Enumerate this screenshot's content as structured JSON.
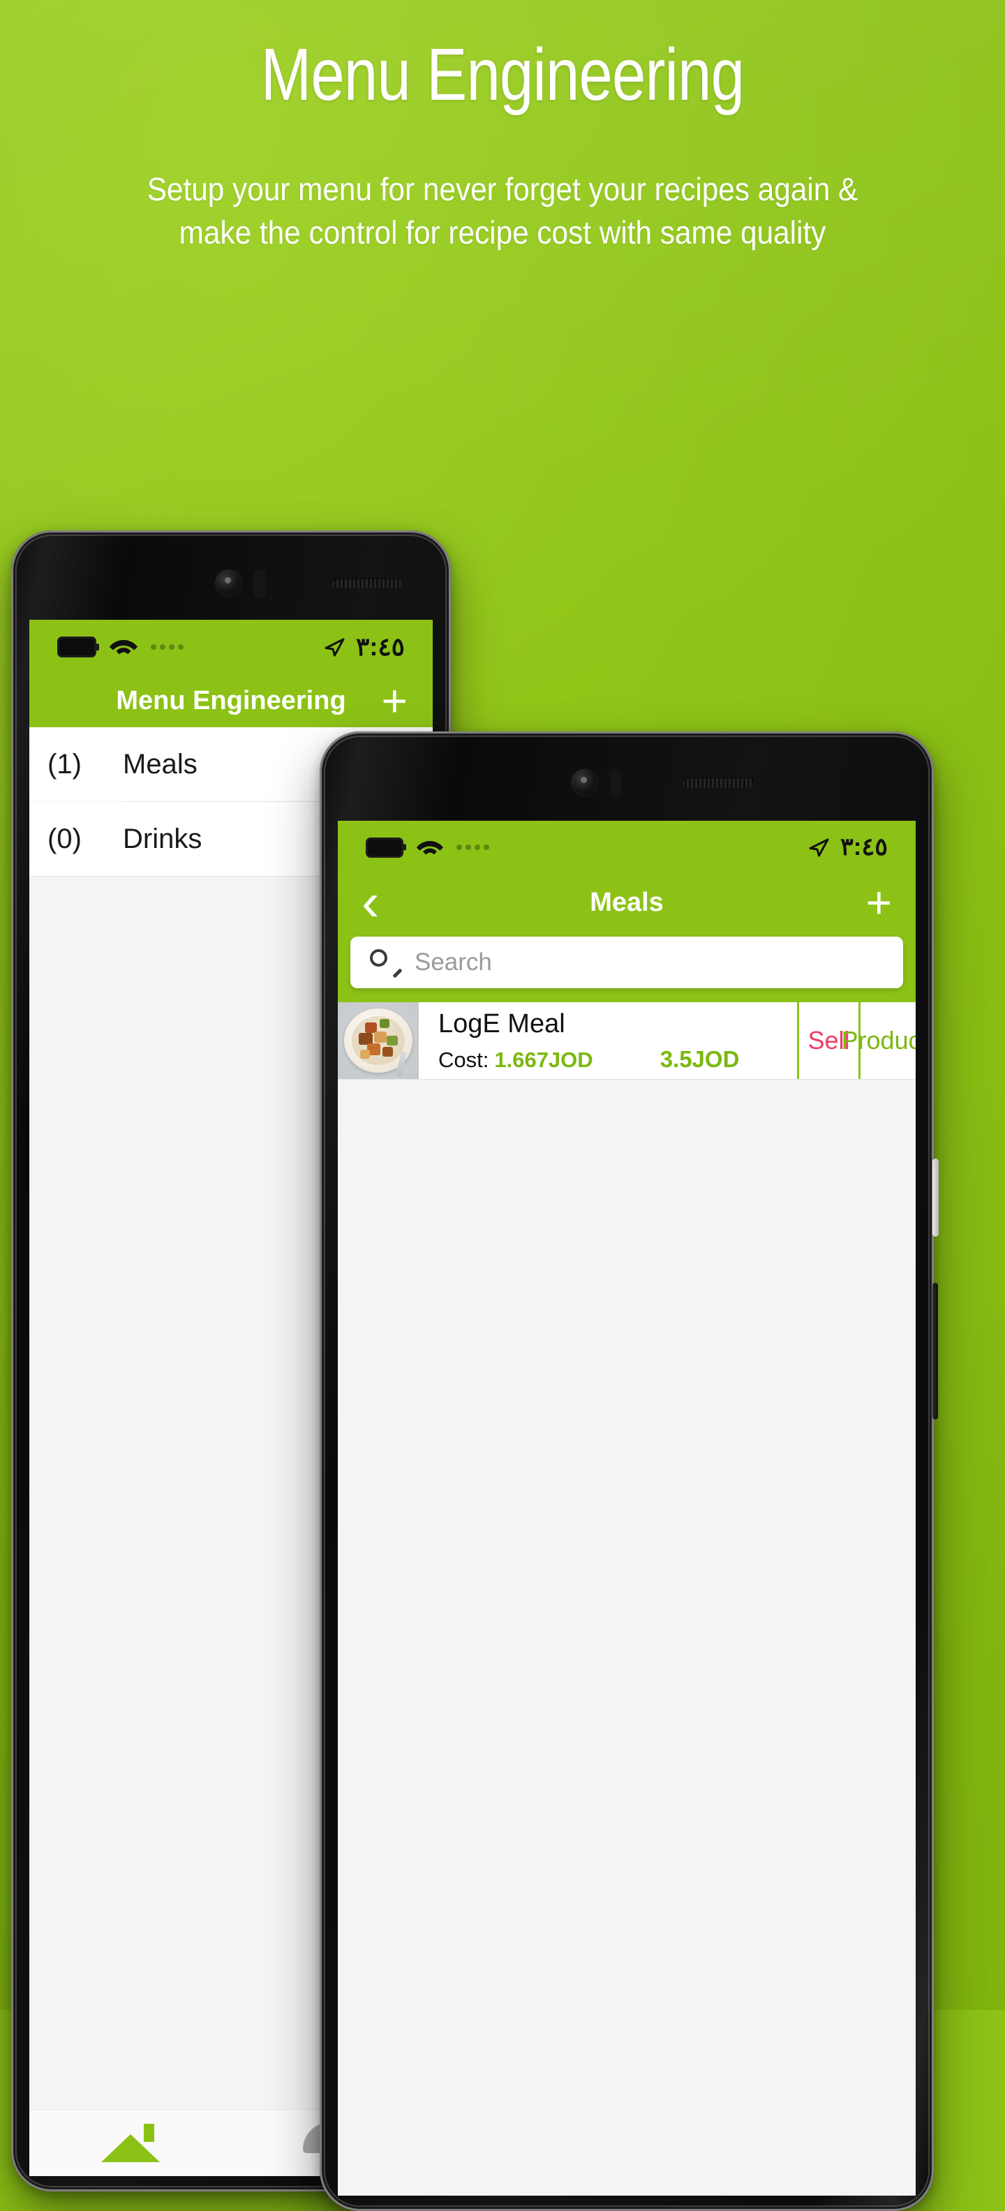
{
  "promo": {
    "title": "Menu Engineering",
    "subtitle": "Setup your menu for never forget your recipes again & make the control for recipe cost with same quality"
  },
  "colors": {
    "brand_green": "#8cc216",
    "accent_green": "#7cb80f",
    "sell_pink": "#ea3f68",
    "screen_bg": "#f4f4f4"
  },
  "phone_back": {
    "status_bar": {
      "battery_icon": "battery-full-icon",
      "wifi_icon": "wifi-icon",
      "signal_icon": "signal-dots-icon",
      "location_icon": "location-arrow-icon",
      "time": "٣:٤٥"
    },
    "nav": {
      "title": "Menu Engineering",
      "add_label": "+"
    },
    "categories": [
      {
        "count": "(1)",
        "name": "Meals"
      },
      {
        "count": "(0)",
        "name": "Drinks"
      }
    ],
    "tabbar": [
      {
        "icon": "home-icon",
        "state": "active"
      },
      {
        "icon": "food-dome-icon",
        "state": "inactive"
      }
    ]
  },
  "phone_front": {
    "status_bar": {
      "battery_icon": "battery-full-icon",
      "wifi_icon": "wifi-icon",
      "signal_icon": "signal-dots-icon",
      "location_icon": "location-arrow-icon",
      "time": "٣:٤٥"
    },
    "nav": {
      "back_label": "‹",
      "title": "Meals",
      "add_label": "+"
    },
    "search": {
      "icon": "search-icon",
      "placeholder": "Search",
      "value": ""
    },
    "meals": [
      {
        "thumbnail": "meal-photo-rice-bowl",
        "name": "LogE Meal",
        "cost_label": "Cost:",
        "cost_value": "1.667JOD",
        "price": "3.5JOD",
        "actions": [
          {
            "label": "Sell",
            "color": "#ea3f68"
          },
          {
            "label": "Produce",
            "color": "#7cb80f"
          }
        ]
      }
    ]
  }
}
